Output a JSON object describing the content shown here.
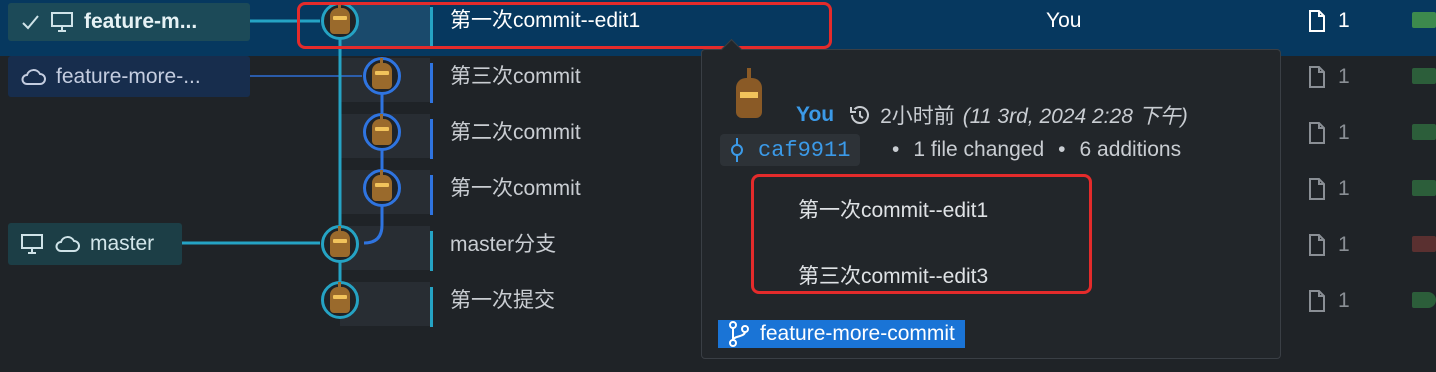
{
  "rows": [
    {
      "message": "第一次commit--edit1",
      "author": "You",
      "files": "1"
    },
    {
      "message": "第三次commit",
      "files": "1"
    },
    {
      "message": "第二次commit",
      "files": "1"
    },
    {
      "message": "第一次commit",
      "files": "1"
    },
    {
      "message": "master分支",
      "files": "1"
    },
    {
      "message": "第一次提交",
      "files": "1"
    }
  ],
  "branches": {
    "local_current": "feature-m...",
    "remote": "feature-more-...",
    "master": "master"
  },
  "popup": {
    "author": "You",
    "relative_time": "2小时前",
    "absolute_time": "(11 3rd, 2024 2:28 下午)",
    "sha": "caf9911",
    "files_changed": "1 file changed",
    "dot1": "•",
    "dot2": "•",
    "additions": "6 additions",
    "body_line1": "第一次commit--edit1",
    "body_line2": "第三次commit--edit3",
    "branch": "feature-more-commit"
  },
  "colors": {
    "selected_row": "#06385f",
    "lane_main": "#25a3c4",
    "lane_branch": "#2f74e0",
    "highlight": "#e42b2b",
    "branch_chip": "#1a74d6"
  },
  "icons": [
    "check-icon",
    "monitor-icon",
    "cloud-icon",
    "file-icon",
    "history-icon",
    "commit-icon",
    "git-branch-icon"
  ]
}
